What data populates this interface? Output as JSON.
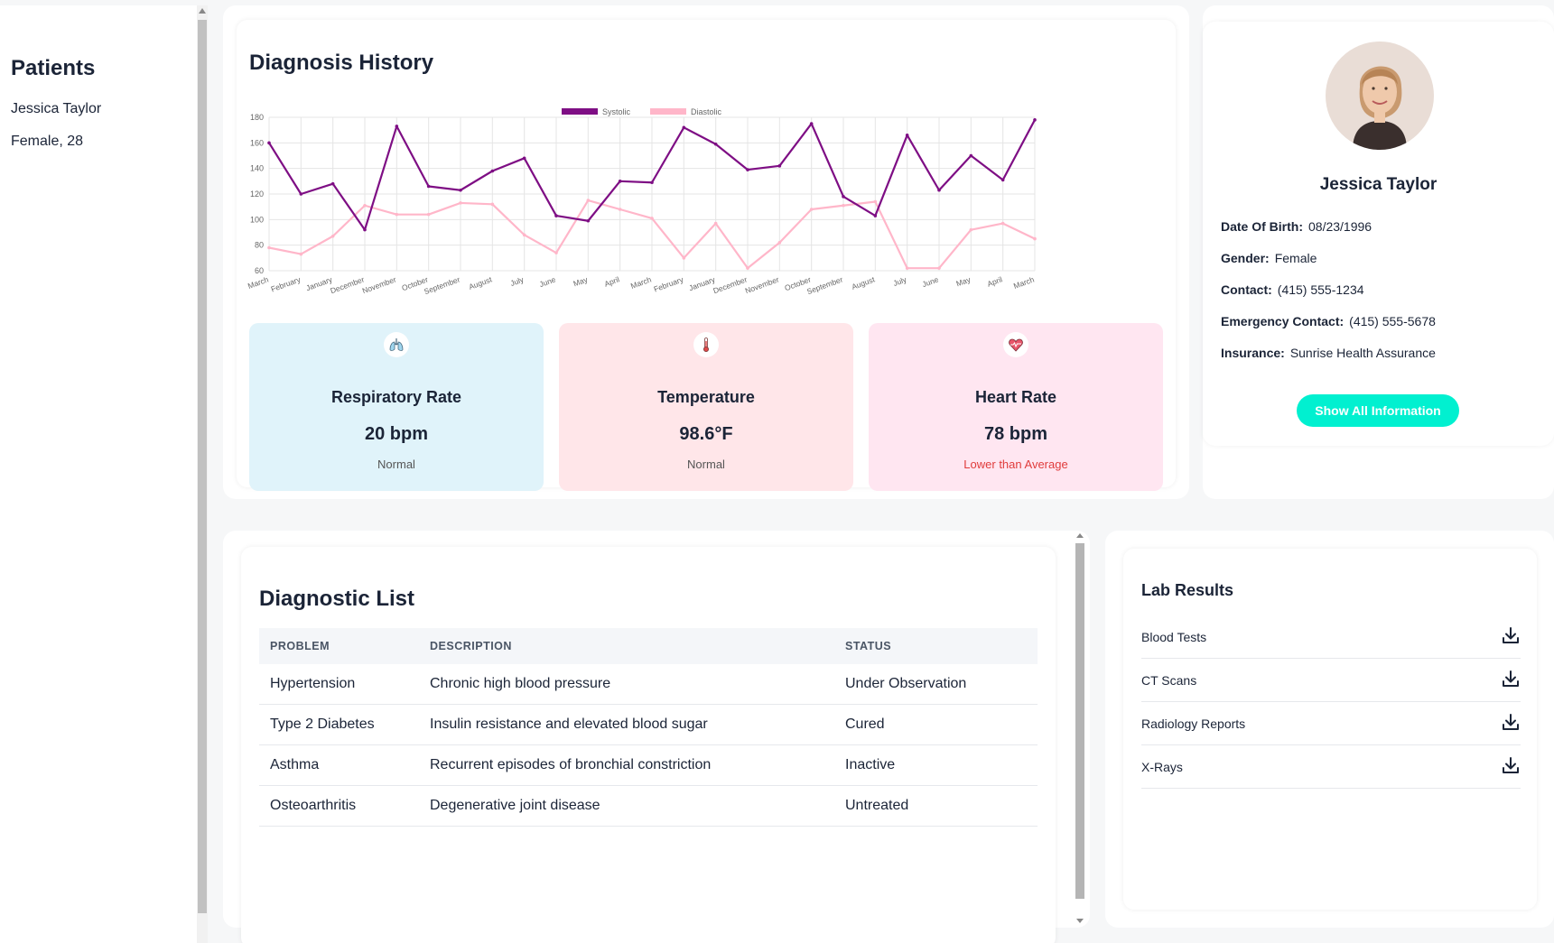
{
  "sidebar": {
    "title": "Patients",
    "patient_name": "Jessica Taylor",
    "patient_meta": "Female, 28"
  },
  "history": {
    "title": "Diagnosis History"
  },
  "chart_data": {
    "type": "line",
    "categories": [
      "March",
      "February",
      "January",
      "December",
      "November",
      "October",
      "September",
      "August",
      "July",
      "June",
      "May",
      "April",
      "March",
      "February",
      "January",
      "December",
      "November",
      "October",
      "September",
      "August",
      "July",
      "June",
      "May",
      "April",
      "March"
    ],
    "series": [
      {
        "name": "Systolic",
        "color": "#7e0e84",
        "values": [
          160,
          120,
          128,
          92,
          173,
          126,
          123,
          138,
          148,
          103,
          99,
          130,
          129,
          172,
          159,
          139,
          142,
          175,
          118,
          103,
          166,
          123,
          150,
          131,
          178
        ]
      },
      {
        "name": "Diastolic",
        "color": "#ffb6c9",
        "values": [
          78,
          73,
          87,
          111,
          104,
          104,
          113,
          112,
          88,
          74,
          115,
          108,
          101,
          70,
          97,
          62,
          82,
          108,
          111,
          114,
          62,
          62,
          92,
          97,
          85
        ]
      }
    ],
    "ylim": [
      60,
      180
    ],
    "yticks": [
      60,
      80,
      100,
      120,
      140,
      160,
      180
    ],
    "grid": true,
    "legend": "top"
  },
  "vitals": [
    {
      "title": "Respiratory Rate",
      "value": "20 bpm",
      "status": "Normal",
      "icon": "lungs-icon",
      "bg": "#e0f3fa"
    },
    {
      "title": "Temperature",
      "value": "98.6°F",
      "status": "Normal",
      "icon": "thermometer-icon",
      "bg": "#ffe6e9"
    },
    {
      "title": "Heart Rate",
      "value": "78 bpm",
      "status": "Lower than Average",
      "icon": "heart-icon",
      "bg": "#ffe6f1"
    }
  ],
  "profile": {
    "name": "Jessica Taylor",
    "dob_label": "Date Of Birth:",
    "dob": "08/23/1996",
    "gender_label": "Gender:",
    "gender": "Female",
    "contact_label": "Contact:",
    "contact": "(415) 555-1234",
    "emergency_label": "Emergency Contact:",
    "emergency": "(415) 555-5678",
    "insurance_label": "Insurance:",
    "insurance": "Sunrise Health Assurance",
    "button": "Show All Information"
  },
  "diagnostic_list": {
    "title": "Diagnostic List",
    "headers": [
      "PROBLEM",
      "DESCRIPTION",
      "STATUS"
    ],
    "rows": [
      [
        "Hypertension",
        "Chronic high blood pressure",
        "Under Observation"
      ],
      [
        "Type 2 Diabetes",
        "Insulin resistance and elevated blood sugar",
        "Cured"
      ],
      [
        "Asthma",
        "Recurrent episodes of bronchial constriction",
        "Inactive"
      ],
      [
        "Osteoarthritis",
        "Degenerative joint disease",
        "Untreated"
      ]
    ]
  },
  "lab_results": {
    "title": "Lab Results",
    "items": [
      "Blood Tests",
      "CT Scans",
      "Radiology Reports",
      "X-Rays"
    ],
    "icon": "download-icon"
  },
  "colors": {
    "accent": "#01f0d0",
    "systolic": "#7e0e84",
    "diastolic": "#ffb6c9",
    "warning": "#e03c3c"
  }
}
